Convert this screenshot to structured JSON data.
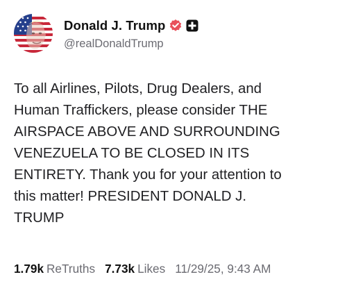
{
  "author": {
    "display_name": "Donald J. Trump",
    "handle": "@realDonaldTrump",
    "avatar_icon": "flag-face-avatar",
    "verified_icon": "verified-badge-icon",
    "org_icon": "organization-badge-icon"
  },
  "post": {
    "text": "To all Airlines, Pilots, Drug Dealers, and\nHuman Traffickers, please consider THE\nAIRSPACE ABOVE AND SURROUNDING\nVENEZUELA TO BE CLOSED IN ITS\nENTIRETY. Thank you for your attention to\nthis matter! PRESIDENT DONALD J.\nTRUMP"
  },
  "stats": {
    "retruths_count": "1.79k",
    "retruths_label": "ReTruths",
    "likes_count": "7.73k",
    "likes_label": "Likes",
    "timestamp": "11/29/25, 9:43 AM"
  },
  "colors": {
    "verified_badge": "#e8505b",
    "muted_text": "#6b6b72",
    "body_text": "#1f1f22"
  }
}
